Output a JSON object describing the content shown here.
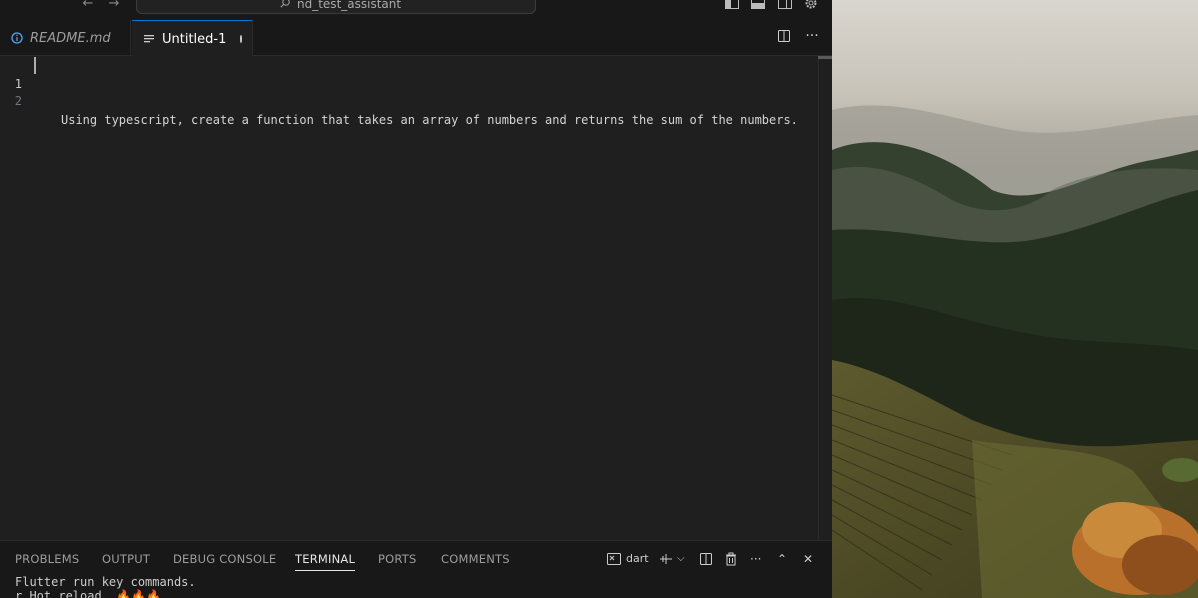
{
  "titlebar": {
    "search_text": "nd_test_assistant"
  },
  "tabs": [
    {
      "label": "README.md",
      "icon": "info-icon",
      "italic": true
    },
    {
      "label": "Untitled-1",
      "icon": "text-lines-icon",
      "dirty": true,
      "active": true
    }
  ],
  "editor": {
    "lines": [
      {
        "number": "1",
        "text": ""
      },
      {
        "number": "2",
        "text": "Using typescript, create a function that takes an array of numbers and returns the sum of the numbers."
      }
    ]
  },
  "panel": {
    "tabs": [
      "PROBLEMS",
      "OUTPUT",
      "DEBUG CONSOLE",
      "TERMINAL",
      "PORTS",
      "COMMENTS"
    ],
    "active_tab": "TERMINAL",
    "terminal_shell_label": "dart",
    "terminal_lines": [
      "Flutter run key commands.",
      "r Hot reload. 🔥🔥🔥"
    ]
  },
  "colors": {
    "accent": "#0078d4",
    "editor_bg": "#1f1f1f",
    "chrome_bg": "#181818"
  }
}
